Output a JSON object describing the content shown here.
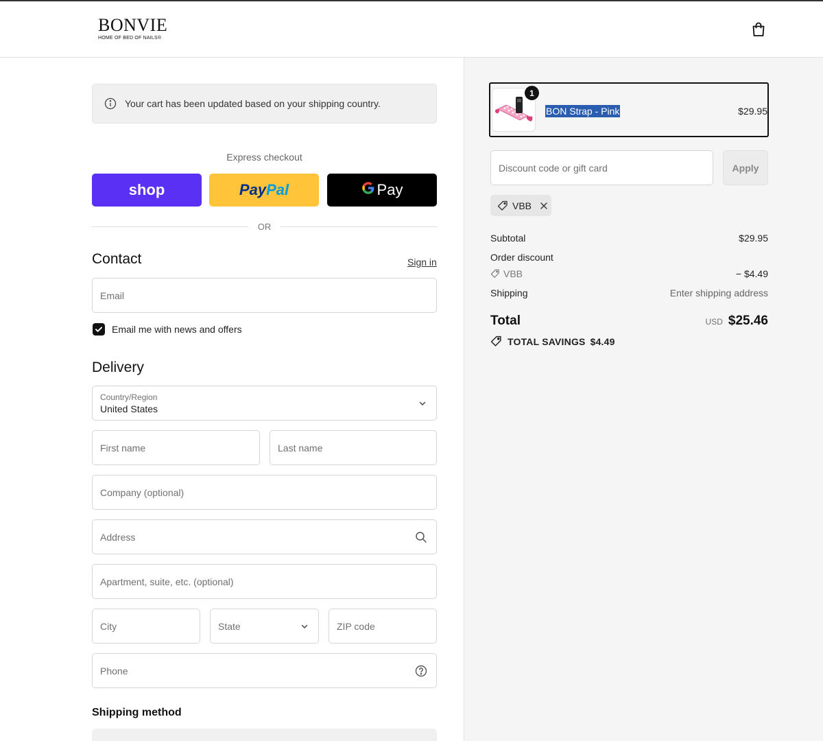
{
  "header": {
    "logo_main": "BONVIE",
    "logo_sub": "HOME OF BED OF NAILS®"
  },
  "notice": {
    "text": "Your cart has been updated based on your shipping country."
  },
  "express": {
    "title": "Express checkout",
    "shop_label": "shop",
    "paypal_a": "Pay",
    "paypal_b": "Pal",
    "gpay_g": "G",
    "gpay_label": "Pay",
    "or_label": "OR"
  },
  "contact": {
    "title": "Contact",
    "signin": "Sign in",
    "email_placeholder": "Email",
    "newsletter_label": "Email me with news and offers",
    "newsletter_checked": true
  },
  "delivery": {
    "title": "Delivery",
    "country_label": "Country/Region",
    "country_value": "United States",
    "first_name_placeholder": "First name",
    "last_name_placeholder": "Last name",
    "company_placeholder": "Company (optional)",
    "address_placeholder": "Address",
    "apartment_placeholder": "Apartment, suite, etc. (optional)",
    "city_placeholder": "City",
    "state_label": "State",
    "zip_placeholder": "ZIP code",
    "phone_placeholder": "Phone"
  },
  "shipping_method": {
    "title": "Shipping method"
  },
  "cart": {
    "item": {
      "quantity": "1",
      "name": "BON Strap - Pink",
      "price": "$29.95"
    },
    "discount_placeholder": "Discount code or gift card",
    "apply_label": "Apply",
    "applied_code": "VBB"
  },
  "summary": {
    "subtotal_label": "Subtotal",
    "subtotal_value": "$29.95",
    "order_discount_label": "Order discount",
    "discount_code": "VBB",
    "discount_value": "− $4.49",
    "shipping_label": "Shipping",
    "shipping_value": "Enter shipping address",
    "total_label": "Total",
    "total_currency": "USD",
    "total_value": "$25.46",
    "savings_label": "TOTAL SAVINGS",
    "savings_value": "$4.49"
  },
  "colors": {
    "shop_pay": "#5a31f4",
    "paypal": "#ffc439",
    "gpay": "#000000",
    "selection": "#2a5db0"
  }
}
